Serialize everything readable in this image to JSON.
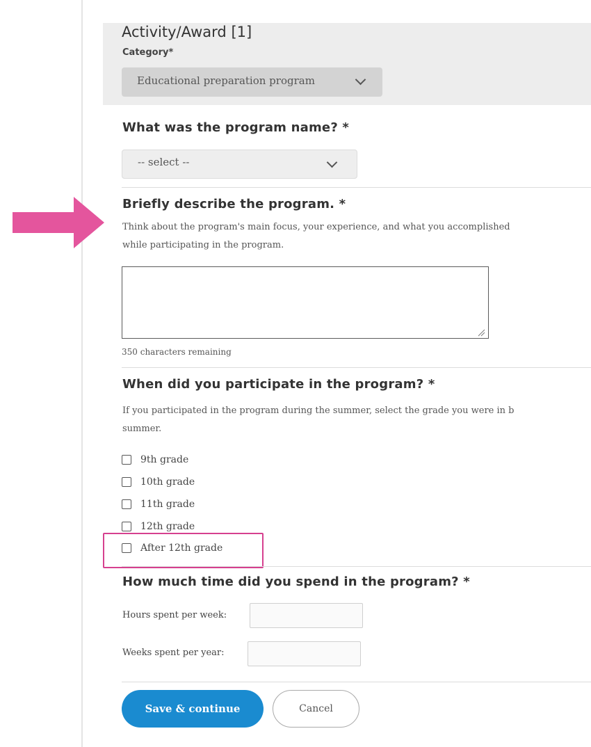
{
  "section": {
    "title": "Activity/Award [1]",
    "category_label": "Category*",
    "category_value": "Educational preparation program"
  },
  "program_name": {
    "question": "What was the program name? *",
    "select_value": "-- select --"
  },
  "description": {
    "question": "Briefly describe the program. *",
    "help_line1": "Think about the program's main focus, your experience, and what you accomplished",
    "help_line2": "while participating in the program.",
    "chars_remaining": "350 characters remaining",
    "value": ""
  },
  "participation": {
    "question": "When did you participate in the program? *",
    "help_line1": "If you participated in the program during the summer, select the grade you were in b",
    "help_line2": "summer.",
    "options": [
      "9th grade",
      "10th grade",
      "11th grade",
      "12th grade",
      "After 12th grade"
    ]
  },
  "time_spent": {
    "question": "How much time did you spend in the program? *",
    "hours_label": "Hours spent per week:",
    "weeks_label": "Weeks spent per year:",
    "hours_value": "",
    "weeks_value": ""
  },
  "actions": {
    "save_label": "Save & continue",
    "cancel_label": "Cancel"
  },
  "colors": {
    "accent_blue": "#1a8bd0",
    "annotation_pink": "#d6408f"
  }
}
